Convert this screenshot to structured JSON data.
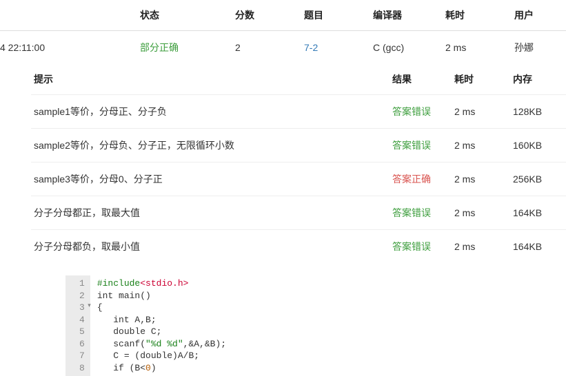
{
  "submission_table": {
    "headers": {
      "time": "",
      "status": "状态",
      "score": "分数",
      "problem": "题目",
      "compiler": "编译器",
      "time_cost": "耗时",
      "user": "用户"
    },
    "row": {
      "time": "4 22:11:00",
      "status": "部分正确",
      "score": "2",
      "problem": "7-2",
      "compiler": "C (gcc)",
      "time_cost": "2 ms",
      "user": "孙娜"
    }
  },
  "testcase_table": {
    "headers": {
      "hint": "提示",
      "result": "结果",
      "time_cost": "耗时",
      "memory": "内存"
    },
    "rows": [
      {
        "hint": "sample1等价，分母正、分子负",
        "result": "答案错误",
        "result_class": "result-wrong",
        "time_cost": "2 ms",
        "memory": "128KB"
      },
      {
        "hint": "sample2等价，分母负、分子正，无限循环小数",
        "result": "答案错误",
        "result_class": "result-wrong",
        "time_cost": "2 ms",
        "memory": "160KB"
      },
      {
        "hint": "sample3等价，分母0、分子正",
        "result": "答案正确",
        "result_class": "result-correct",
        "time_cost": "2 ms",
        "memory": "256KB"
      },
      {
        "hint": "分子分母都正，取最大值",
        "result": "答案错误",
        "result_class": "result-wrong",
        "time_cost": "2 ms",
        "memory": "164KB"
      },
      {
        "hint": "分子分母都负，取最小值",
        "result": "答案错误",
        "result_class": "result-wrong",
        "time_cost": "2 ms",
        "memory": "164KB"
      }
    ]
  },
  "code": {
    "lines": [
      {
        "n": "1",
        "tokens": [
          {
            "t": "#include",
            "c": "kw-include"
          },
          {
            "t": "<stdio.h>",
            "c": "kw-header"
          }
        ]
      },
      {
        "n": "2",
        "tokens": [
          {
            "t": "int",
            "c": ""
          },
          {
            "t": " main()",
            "c": ""
          }
        ]
      },
      {
        "n": "3",
        "fold": true,
        "tokens": [
          {
            "t": "{",
            "c": ""
          }
        ]
      },
      {
        "n": "4",
        "tokens": [
          {
            "t": "   int",
            "c": ""
          },
          {
            "t": " A,B;",
            "c": ""
          }
        ]
      },
      {
        "n": "5",
        "tokens": [
          {
            "t": "   double",
            "c": ""
          },
          {
            "t": " C;",
            "c": ""
          }
        ]
      },
      {
        "n": "6",
        "tokens": [
          {
            "t": "   scanf(",
            "c": ""
          },
          {
            "t": "\"%d %d\"",
            "c": "kw-str"
          },
          {
            "t": ",&A,&B);",
            "c": ""
          }
        ]
      },
      {
        "n": "7",
        "tokens": [
          {
            "t": "   C = (",
            "c": ""
          },
          {
            "t": "double",
            "c": ""
          },
          {
            "t": ")A/B;",
            "c": ""
          }
        ]
      },
      {
        "n": "8",
        "tokens": [
          {
            "t": "   if",
            "c": ""
          },
          {
            "t": " (B<",
            "c": ""
          },
          {
            "t": "0",
            "c": "kw-num"
          },
          {
            "t": ")",
            "c": ""
          }
        ]
      }
    ]
  }
}
